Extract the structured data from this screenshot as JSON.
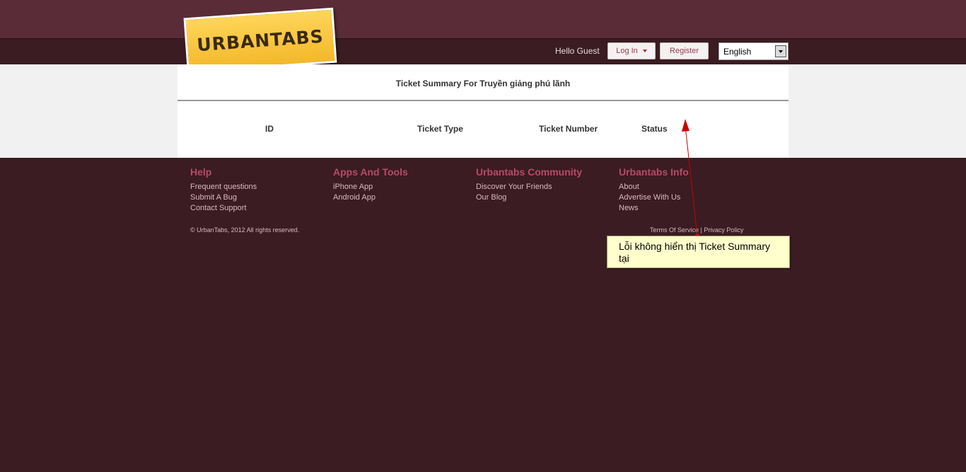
{
  "header": {
    "logo_text": "URBANTABS",
    "greeting": "Hello Guest",
    "login_label": "Log In",
    "register_label": "Register",
    "language": "English"
  },
  "ticket_summary": {
    "title": "Ticket Summary For Truyền giảng phú lãnh",
    "columns": [
      "ID",
      "Ticket Type",
      "Ticket Number",
      "Status"
    ]
  },
  "footer": {
    "columns": [
      {
        "heading": "Help",
        "links": [
          "Frequent questions",
          "Submit A Bug",
          "Contact Support"
        ]
      },
      {
        "heading": "Apps And Tools",
        "links": [
          "iPhone App",
          "Android App"
        ]
      },
      {
        "heading": "Urbantabs Community",
        "links": [
          "Discover Your Friends",
          "Our Blog"
        ]
      },
      {
        "heading": "Urbantabs Info",
        "links": [
          "About",
          "Advertise With Us",
          "News"
        ]
      }
    ],
    "copyright": "© UrbanTabs, 2012 All rights reserved.",
    "terms": "Terms Of Service",
    "separator": "|",
    "privacy": "Privacy Policy"
  },
  "annotation": {
    "text": "Lỗi không hiển thị Ticket Summary tại",
    "arrow_color": "#cc0000"
  },
  "colors": {
    "page_bg": "#3a1c22",
    "top_band": "#5a2c38",
    "footer_heading": "#b84a68",
    "footer_link": "#dcb7c2",
    "logo_yellow": "#f3b82a"
  }
}
